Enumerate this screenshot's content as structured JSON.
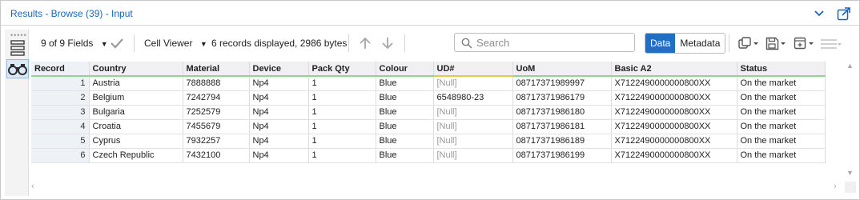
{
  "window": {
    "title": "Results - Browse (39) - Input"
  },
  "toolbar": {
    "fields_label": "9 of 9 Fields",
    "viewer_label": "Cell Viewer",
    "records_info": "6 records displayed, 2986 bytes",
    "search_placeholder": "Search",
    "data_tab": "Data",
    "metadata_tab": "Metadata"
  },
  "colors": {
    "accent": "#1f6fc6",
    "title_text": "#1a65b8",
    "header_valid_underline": "#8fd48f",
    "header_warn_underline": "#f0c24a",
    "null_text": "#9a9a9a"
  },
  "grid": {
    "columns": [
      "Record",
      "Country",
      "Material",
      "Device",
      "Pack Qty",
      "Colour",
      "UD#",
      "UoM",
      "Basic A2",
      "Status"
    ],
    "rows": [
      [
        "1",
        "Austria",
        "7888888",
        "Np4",
        "1",
        "Blue",
        "[Null]",
        "08717371989997",
        "X7122490000000800XX",
        "On the market"
      ],
      [
        "2",
        "Belgium",
        "7242794",
        "Np4",
        "1",
        "Blue",
        "6548980-23",
        "08717371986179",
        "X7122490000000800XX",
        "On the market"
      ],
      [
        "3",
        "Bulgaria",
        "7252579",
        "Np4",
        "1",
        "Blue",
        "[Null]",
        "08717371986180",
        "X7122490000000800XX",
        "On the market"
      ],
      [
        "4",
        "Croatia",
        "7455679",
        "Np4",
        "1",
        "Blue",
        "[Null]",
        "08717371986181",
        "X7122490000000800XX",
        "On the market"
      ],
      [
        "5",
        "Cyprus",
        "7932257",
        "Np4",
        "1",
        "Blue",
        "[Null]",
        "08717371986189",
        "X7122490000000800XX",
        "On the market"
      ],
      [
        "6",
        "Czech Republic",
        "7432100",
        "Np4",
        "1",
        "Blue",
        "[Null]",
        "08717371986199",
        "X7122490000000800XX",
        "On the market"
      ]
    ]
  }
}
